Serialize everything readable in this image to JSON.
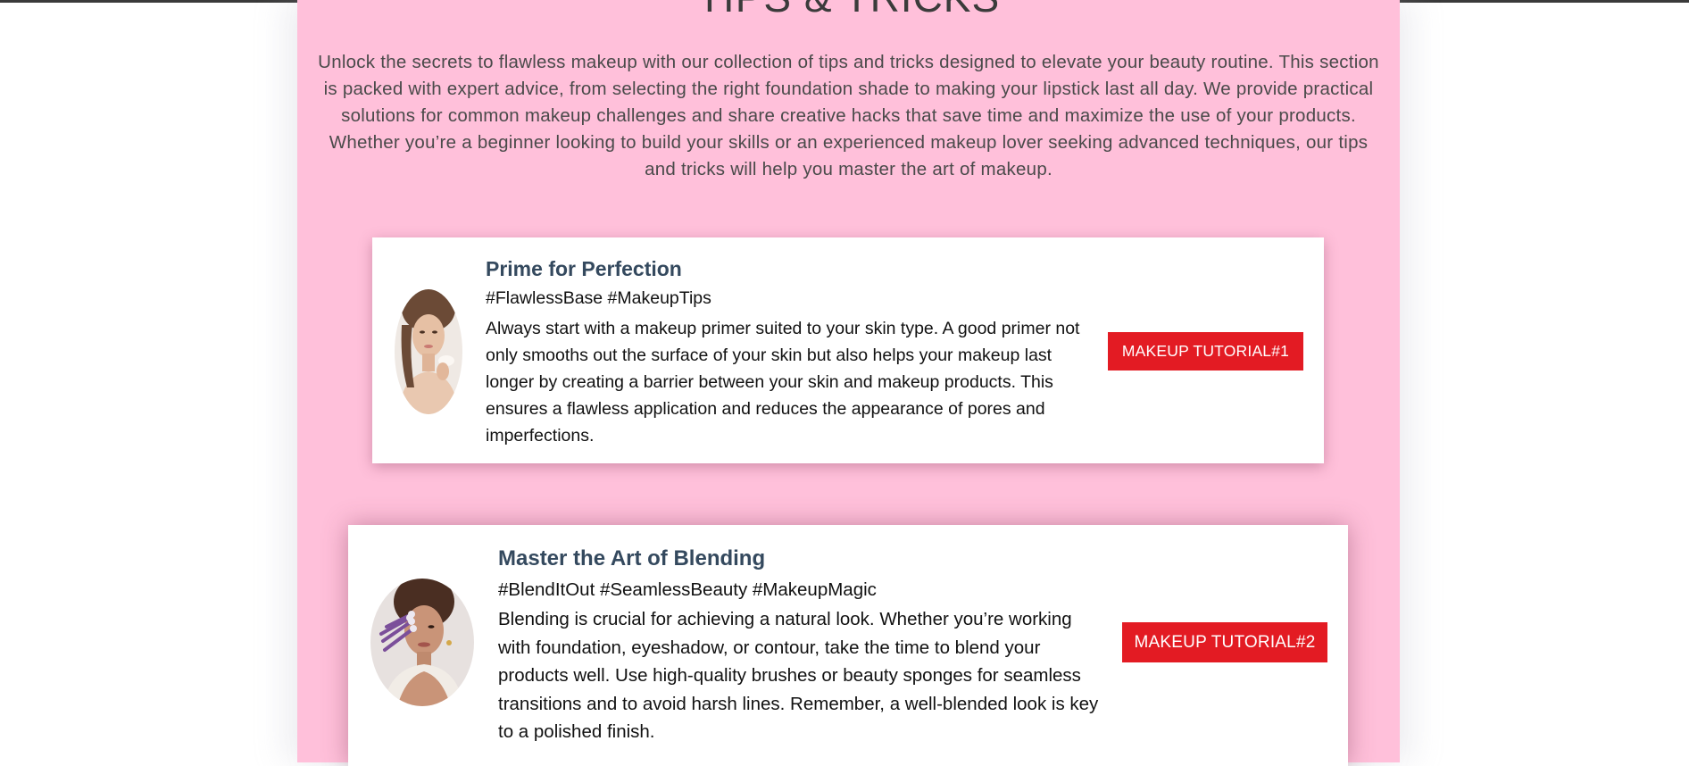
{
  "section": {
    "title": "TIPS & TRICKS",
    "intro": "Unlock the secrets to flawless makeup with our collection of tips and tricks designed to elevate your beauty routine. This section is packed with expert advice, from selecting the right foundation shade to making your lipstick last all day. We provide practical solutions for common makeup challenges and share creative hacks that save time and maximize the use of your products. Whether you’re a beginner looking to build your skills or an experienced makeup lover seeking advanced techniques, our tips and tricks will help you master the art of makeup."
  },
  "cards": [
    {
      "title": "Prime for Perfection",
      "tags": "#FlawlessBase #MakeupTips",
      "description": "Always start with a makeup primer suited to your skin type. A good primer not only smooths out the surface of your skin but also helps your makeup last longer by creating a barrier between your skin and makeup products. This ensures a flawless application and reduces the appearance of pores and imperfections.",
      "button_label": "MAKEUP TUTORIAL#1"
    },
    {
      "title": "Master the Art of Blending",
      "tags": "#BlendItOut #SeamlessBeauty #MakeupMagic",
      "description": "Blending is crucial for achieving a natural look. Whether you’re working with foundation, eyeshadow, or contour, take the time to blend your products well. Use high-quality brushes or beauty sponges for seamless transitions and to avoid harsh lines. Remember, a well-blended look is key to a polished finish.",
      "button_label": "MAKEUP TUTORIAL#2"
    }
  ],
  "colors": {
    "section_background": "#ffc0da",
    "card_title": "#34495e",
    "button": "#e31b23"
  }
}
